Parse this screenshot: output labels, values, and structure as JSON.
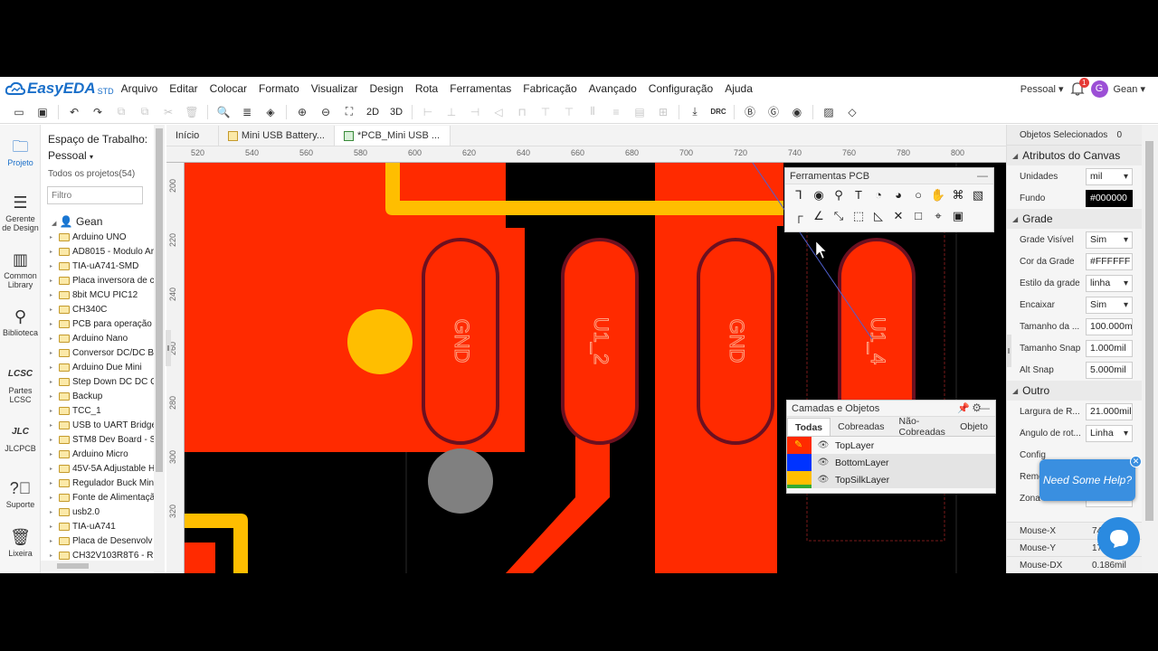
{
  "app": {
    "logo_text": "EasyEDA",
    "logo_suffix": "STD",
    "brand_color": "#1a6fc9"
  },
  "menu": [
    "Arquivo",
    "Editar",
    "Colocar",
    "Formato",
    "Visualizar",
    "Design",
    "Rota",
    "Ferramentas",
    "Fabricação",
    "Avançado",
    "Configuração",
    "Ajuda"
  ],
  "header_right": {
    "workspace": "Pessoal ▾",
    "notifications": "1",
    "avatar_letter": "G",
    "user": "Gean ▾"
  },
  "toolbar": {
    "view_2d": "2D",
    "view_3d": "3D",
    "drc": "DRC"
  },
  "leftnav": {
    "project": "Projeto",
    "design_manager": "Gerente de Design",
    "common_library": "Common Library",
    "library": "Biblioteca",
    "lcsc_parts": "Partes LCSC",
    "jlcpcb": "JLCPCB",
    "support": "Suporte",
    "trash": "Lixeira"
  },
  "project_panel": {
    "workspace_title": "Espaço de Trabalho:",
    "workspace_value": "Pessoal",
    "all_projects": "Todos os projetos(54)",
    "filter_placeholder": "Filtro",
    "user": "Gean",
    "projects": [
      "Arduino UNO",
      "AD8015 - Modulo Ar",
      "TIA-uA741-SMD",
      "Placa inversora de c",
      "8bit MCU PIC12",
      "CH340C",
      "PCB para operação",
      "Arduino Nano",
      "Conversor DC/DC B",
      "Arduino Due Mini",
      "Step Down DC DC C",
      "Backup",
      "TCC_1",
      "USB to UART Bridge",
      "STM8 Dev Board - S",
      "Arduino Micro",
      "45V-5A Adjustable H",
      "Regulador Buck Min",
      "Fonte de Alimentaçã",
      "usb2.0",
      "TIA-uA741",
      "Placa de Desenvolv",
      "CH32V103R8T6 - R"
    ]
  },
  "tabs": [
    {
      "label": "Início"
    },
    {
      "label": "Mini USB Battery..."
    },
    {
      "label": "*PCB_Mini USB ..."
    }
  ],
  "ruler": {
    "top": [
      "520",
      "540",
      "560",
      "580",
      "600",
      "620",
      "640",
      "660",
      "680",
      "700",
      "720",
      "740",
      "760",
      "780",
      "800"
    ],
    "left": [
      "200",
      "220",
      "240",
      "260",
      "280",
      "300",
      "320"
    ]
  },
  "pcb": {
    "pad_labels": [
      "GND",
      "U1_2",
      "GND",
      "U1_4"
    ],
    "colors": {
      "copper_top": "#ff2a00",
      "track": "#ffbe00",
      "pad_outline": "#6b1020",
      "via": "#808080",
      "background": "#000000"
    }
  },
  "pcb_tools": {
    "title": "Ferramentas PCB"
  },
  "layers_panel": {
    "title": "Camadas e Objetos",
    "tabs": [
      "Todas",
      "Cobreadas",
      "Não-Cobreadas",
      "Objeto"
    ],
    "layers": [
      {
        "name": "TopLayer",
        "color": "#ff2a00"
      },
      {
        "name": "BottomLayer",
        "color": "#0033ff"
      },
      {
        "name": "TopSilkLayer",
        "color": "#ffbe00"
      }
    ]
  },
  "right_panel": {
    "selected_label": "Objetos Selecionados",
    "selected_count": "0",
    "canvas_section": "Atributos do Canvas",
    "units_label": "Unidades",
    "units_value": "mil",
    "background_label": "Fundo",
    "background_value": "#000000",
    "grid_section": "Grade",
    "grid_visible_label": "Grade Visível",
    "grid_visible_value": "Sim",
    "grid_color_label": "Cor da Grade",
    "grid_color_value": "#FFFFFF",
    "grid_style_label": "Estilo da grade",
    "grid_style_value": "linha",
    "snap_label": "Encaixar",
    "snap_value": "Sim",
    "size_label": "Tamanho da ...",
    "size_value": "100.000m",
    "snap_size_label": "Tamanho Snap",
    "snap_size_value": "1.000mil",
    "alt_snap_label": "Alt Snap",
    "alt_snap_value": "5.000mil",
    "other_section": "Outro",
    "width_label": "Largura de R...",
    "width_value": "21.000mil",
    "angle_label": "Ângulo de rot...",
    "angle_value": "Linha",
    "config_label": "Config",
    "remove_label": "Remo",
    "copper_zone_label": "Zona de Cobre",
    "copper_zone_value": "Visív",
    "mouse_x_label": "Mouse-X",
    "mouse_x_value": "746.",
    "mouse_y_label": "Mouse-Y",
    "mouse_y_value": "179.0",
    "mouse_dx_label": "Mouse-DX",
    "mouse_dx_value": "0.186mil"
  },
  "help": {
    "text": "Need Some Help?"
  }
}
